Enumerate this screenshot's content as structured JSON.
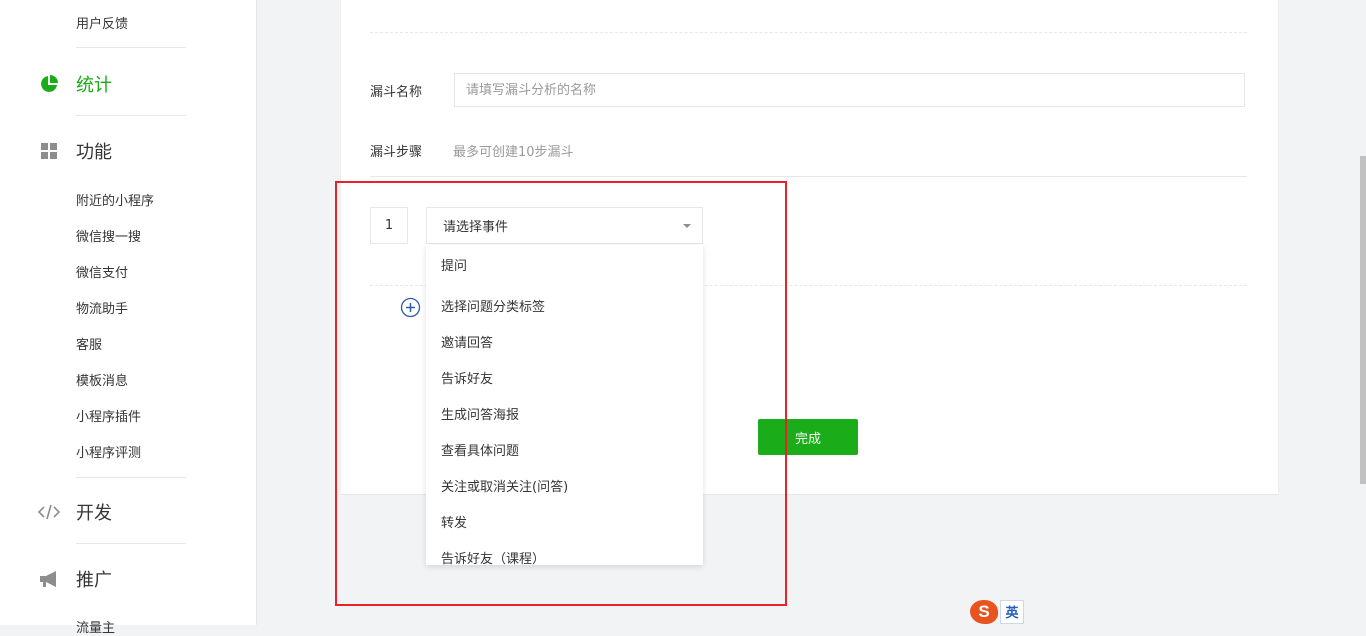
{
  "sidebar": {
    "top_item": "用户反馈",
    "stats_label": "统计",
    "features_label": "功能",
    "feature_items": [
      "附近的小程序",
      "微信搜一搜",
      "微信支付",
      "物流助手",
      "客服",
      "模板消息",
      "小程序插件",
      "小程序评测"
    ],
    "dev_label": "开发",
    "promo_label": "推广",
    "promo_partial_item": "流量主"
  },
  "form": {
    "name_label": "漏斗名称",
    "name_placeholder": "请填写漏斗分析的名称",
    "steps_label": "漏斗步骤",
    "steps_hint": "最多可创建10步漏斗",
    "step_number": "1",
    "select_value": "请选择事件",
    "done_label": "完成"
  },
  "dropdown": {
    "options": [
      "提问",
      "选择问题分类标签",
      "邀请回答",
      "告诉好友",
      "生成问答海报",
      "查看具体问题",
      "关注或取消关注(问答)",
      "转发",
      "告诉好友（课程）"
    ]
  },
  "ime": {
    "logo": "S",
    "lang": "英"
  },
  "colors": {
    "accent": "#1aad19",
    "highlight": "#e8212a"
  }
}
